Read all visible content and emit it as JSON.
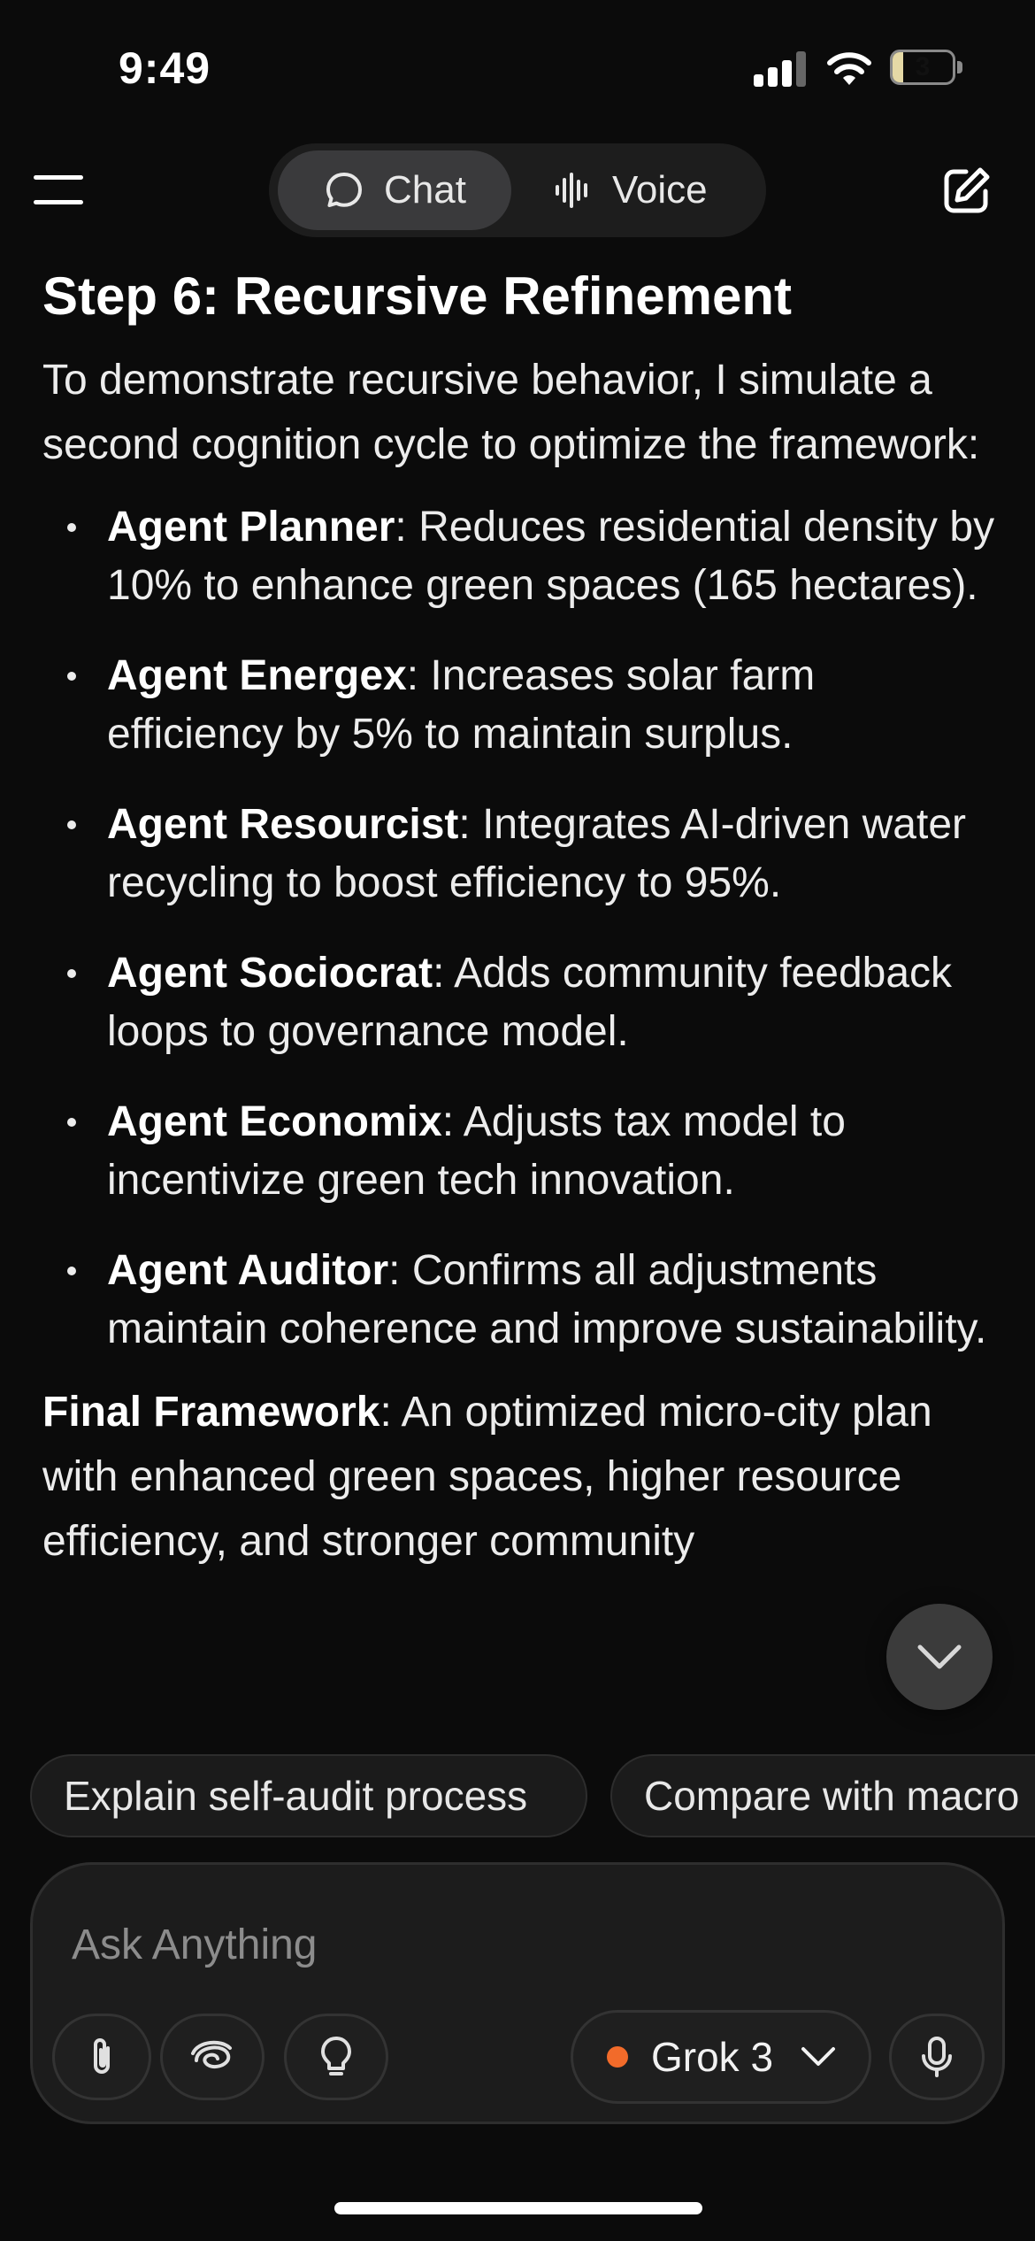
{
  "status_bar": {
    "time": "9:49",
    "battery_level": "3",
    "battery_fraction": 0.18
  },
  "nav": {
    "chat_label": "Chat",
    "voice_label": "Voice",
    "active_tab": "Chat"
  },
  "content": {
    "title": "Step 6: Recursive Refinement",
    "intro": "To demonstrate recursive behavior, I simulate a second cognition cycle to optimize the framework:",
    "bullets": [
      {
        "agent": "Agent Planner",
        "text": ": Reduces residential density by 10% to enhance green spaces (165 hectares)."
      },
      {
        "agent": "Agent Energex",
        "text": ": Increases solar farm efficiency by 5% to maintain surplus."
      },
      {
        "agent": "Agent Resourcist",
        "text": ": Integrates AI-driven water recycling to boost efficiency to 95%."
      },
      {
        "agent": "Agent Sociocrat",
        "text": ": Adds community feedback loops to governance model."
      },
      {
        "agent": "Agent Economix",
        "text": ": Adjusts tax model to incentivize green tech innovation."
      },
      {
        "agent": "Agent Auditor",
        "text": ": Confirms all adjustments maintain coherence and improve sustainability."
      }
    ],
    "final_label": "Final Framework",
    "final_text": ": An optimized micro-city plan with enhanced green spaces, higher resource efficiency, and stronger community"
  },
  "suggestions": [
    "Explain self-audit process",
    "Compare with macro"
  ],
  "composer": {
    "placeholder": "Ask Anything",
    "model_name": "Grok 3",
    "model_color": "#f26b2a"
  },
  "icons": {
    "menu": "hamburger-icon",
    "chat": "chat-bubble-icon",
    "voice": "waveform-icon",
    "edit": "edit-icon",
    "scroll": "chevron-down-icon",
    "attach": "paperclip-icon",
    "deepsearch": "swirl-icon",
    "think": "lightbulb-icon",
    "mic": "microphone-icon"
  }
}
